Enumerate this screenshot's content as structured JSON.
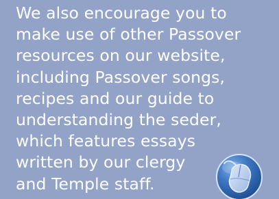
{
  "content": {
    "lines": [
      "We also encourage you to",
      "make use of other Passover",
      "resources on our website,",
      "including Passover songs,",
      "recipes and our guide to",
      "understanding the seder,",
      "which features essays",
      "written by our clergy",
      "and Temple staff."
    ]
  },
  "icons": {
    "badge": "computer-mouse-icon"
  },
  "colors": {
    "background": "#93a3c7",
    "text": "#ffffff",
    "badge_blue": "#2f63ab"
  }
}
